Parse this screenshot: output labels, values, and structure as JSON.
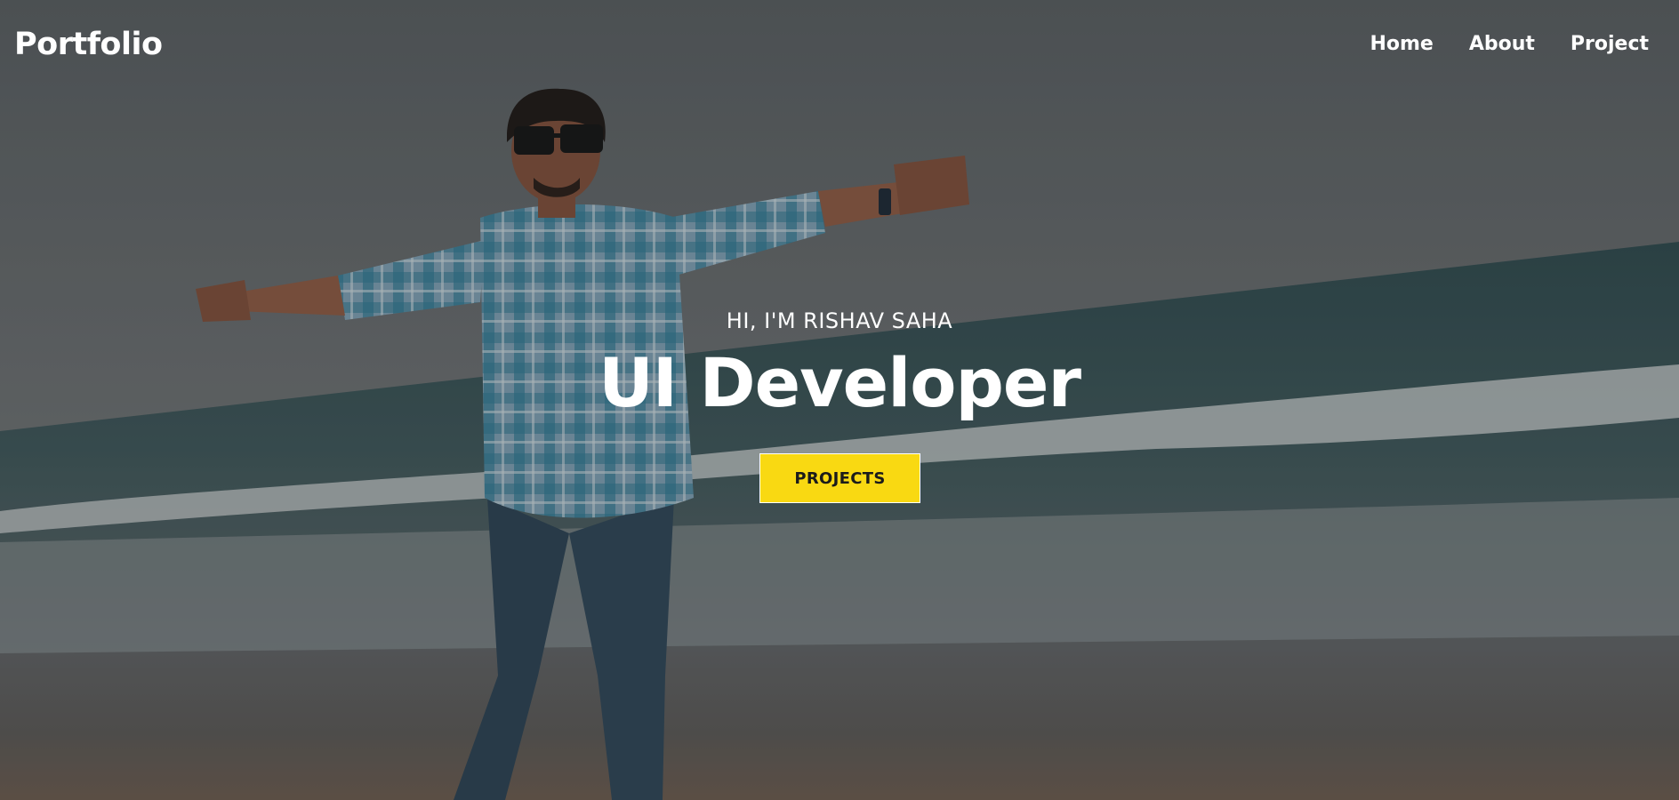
{
  "nav": {
    "brand": "Portfolio",
    "links": [
      {
        "label": "Home"
      },
      {
        "label": "About"
      },
      {
        "label": "Project"
      }
    ]
  },
  "hero": {
    "greeting": "HI, I'M RISHAV SAHA",
    "role": "UI Developer",
    "cta_label": "PROJECTS",
    "background_photo": "person-on-beach-arms-outstretched"
  },
  "colors": {
    "accent": "#f9d912",
    "text": "#ffffff",
    "button_text": "#1b1b1b"
  }
}
